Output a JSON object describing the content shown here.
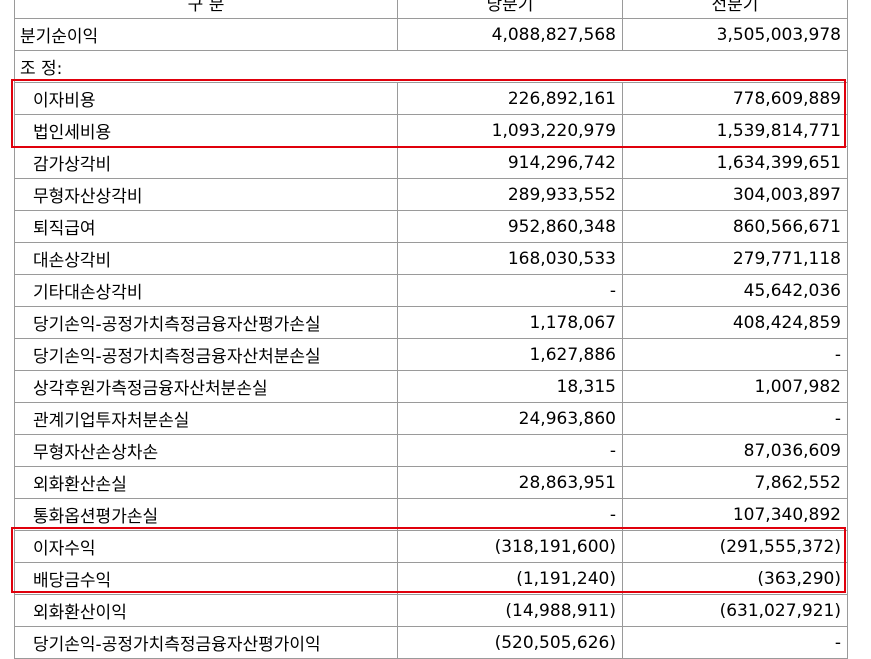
{
  "header": [
    "구 분",
    "당분기",
    "전분기"
  ],
  "rows": [
    {
      "label": "분기순이익",
      "current": "4,088,827,568",
      "prior": "3,505,003,978"
    },
    {
      "label": "조 정:",
      "current": "",
      "prior": ""
    },
    {
      "label": "이자비용",
      "current": "226,892,161",
      "prior": "778,609,889"
    },
    {
      "label": "법인세비용",
      "current": "1,093,220,979",
      "prior": "1,539,814,771"
    },
    {
      "label": "감가상각비",
      "current": "914,296,742",
      "prior": "1,634,399,651"
    },
    {
      "label": "무형자산상각비",
      "current": "289,933,552",
      "prior": "304,003,897"
    },
    {
      "label": "퇴직급여",
      "current": "952,860,348",
      "prior": "860,566,671"
    },
    {
      "label": "대손상각비",
      "current": "168,030,533",
      "prior": "279,771,118"
    },
    {
      "label": "기타대손상각비",
      "current": "-",
      "prior": "45,642,036"
    },
    {
      "label": "당기손익-공정가치측정금융자산평가손실",
      "current": "1,178,067",
      "prior": "408,424,859"
    },
    {
      "label": "당기손익-공정가치측정금융자산처분손실",
      "current": "1,627,886",
      "prior": "-"
    },
    {
      "label": "상각후원가측정금융자산처분손실",
      "current": "18,315",
      "prior": "1,007,982"
    },
    {
      "label": "관계기업투자처분손실",
      "current": "24,963,860",
      "prior": "-"
    },
    {
      "label": "무형자산손상차손",
      "current": "-",
      "prior": "87,036,609"
    },
    {
      "label": "외화환산손실",
      "current": "28,863,951",
      "prior": "7,862,552"
    },
    {
      "label": "통화옵션평가손실",
      "current": "-",
      "prior": "107,340,892"
    },
    {
      "label": "이자수익",
      "current": "(318,191,600)",
      "prior": "(291,555,372)"
    },
    {
      "label": "배당금수익",
      "current": "(1,191,240)",
      "prior": "(363,290)"
    },
    {
      "label": "외화환산이익",
      "current": "(14,988,911)",
      "prior": "(631,027,921)"
    },
    {
      "label": "당기손익-공정가치측정금융자산평가이익",
      "current": "(520,505,626)",
      "prior": "-"
    }
  ],
  "highlight_color": "#e0000c"
}
